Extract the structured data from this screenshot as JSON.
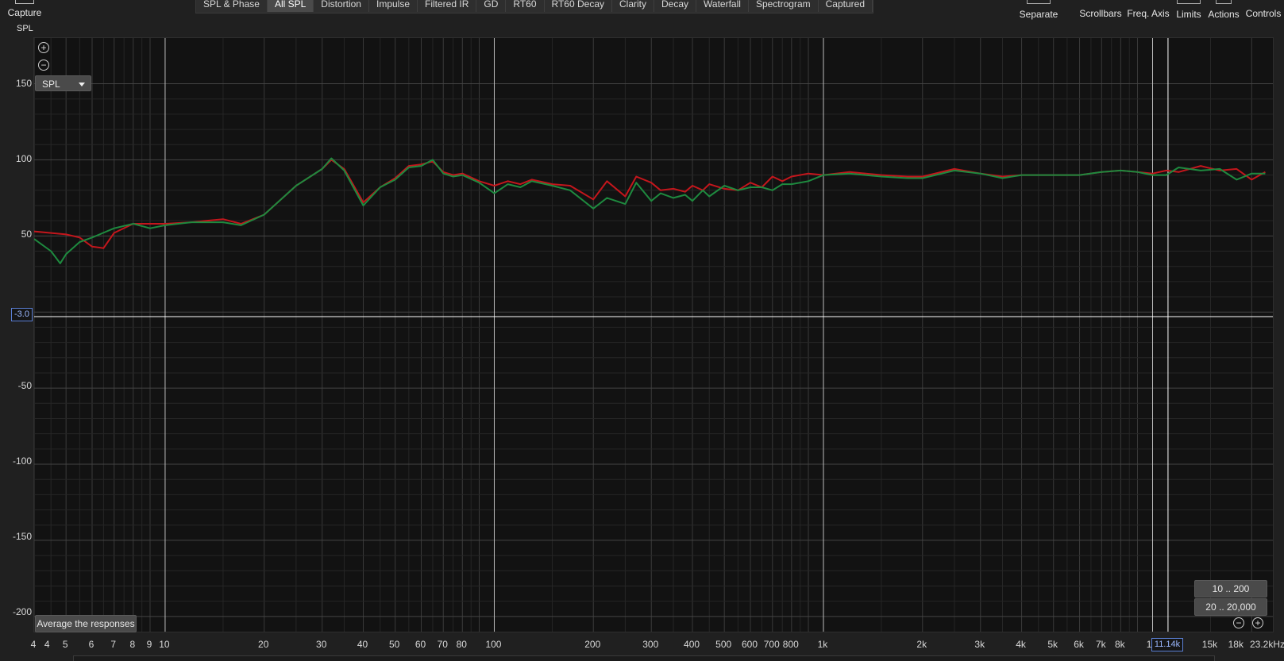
{
  "toolbar": {
    "capture_label": "Capture",
    "tabs": [
      "SPL & Phase",
      "All SPL",
      "Distortion",
      "Impulse",
      "Filtered IR",
      "GD",
      "RT60",
      "RT60 Decay",
      "Clarity",
      "Decay",
      "Waterfall",
      "Spectrogram",
      "Captured"
    ],
    "active_tab": "All SPL",
    "right_buttons": {
      "separate": "Separate",
      "scrollbars": "Scrollbars",
      "freq_axis": "Freq. Axis",
      "limits": "Limits",
      "actions": "Actions",
      "controls": "Controls"
    }
  },
  "graph": {
    "y_axis_title": "SPL",
    "spl_select": "SPL",
    "average_button": "Average the responses",
    "range_buttons": [
      "10 .. 200",
      "20 .. 20,000"
    ],
    "cursor_y_value": "-3.0",
    "cursor_x_value": "11.14k",
    "x_unit_label": "23.2kHz",
    "y_tick_labels": [
      "150",
      "100",
      "50",
      "-50",
      "-100",
      "-150",
      "-200"
    ],
    "x_tick_labels": [
      "4",
      "4",
      "5",
      "6",
      "7",
      "8",
      "9",
      "10",
      "20",
      "30",
      "40",
      "50",
      "60",
      "70",
      "80",
      "100",
      "200",
      "300",
      "400",
      "500",
      "600",
      "700",
      "800",
      "1k",
      "2k",
      "3k",
      "4k",
      "5k",
      "6k",
      "7k",
      "8k",
      "10",
      "15k",
      "18k"
    ],
    "colors": {
      "grid": "#3a3a3a",
      "grid_major": "#bdbdbd",
      "curve_red": "#c4161c",
      "curve_green": "#1e8a3f",
      "cursor": "#ffffff"
    }
  },
  "chart_data": {
    "type": "line",
    "x_scale": "log",
    "xlim": [
      4,
      23200
    ],
    "ylim": [
      -210,
      180
    ],
    "series": [
      {
        "color": "#c4161c",
        "x": [
          4,
          5,
          5.5,
          6,
          6.5,
          7,
          8,
          9,
          10,
          12,
          15,
          17,
          20,
          25,
          30,
          32,
          35,
          40,
          45,
          50,
          55,
          60,
          65,
          70,
          75,
          80,
          90,
          100,
          110,
          120,
          130,
          150,
          170,
          200,
          220,
          250,
          270,
          300,
          320,
          350,
          380,
          400,
          430,
          450,
          500,
          550,
          600,
          650,
          700,
          750,
          800,
          900,
          1000,
          1200,
          1500,
          1800,
          2000,
          2500,
          3000,
          3500,
          4000,
          5000,
          6000,
          7000,
          8000,
          9000,
          10000,
          11000,
          12000,
          14000,
          16000,
          18000,
          20000,
          22000
        ],
        "y": [
          53,
          51,
          49,
          43,
          42,
          52,
          58,
          58,
          58,
          59,
          61,
          58,
          64,
          83,
          94,
          100,
          94,
          72,
          82,
          88,
          96,
          97,
          99,
          92,
          90,
          91,
          86,
          83,
          86,
          84,
          87,
          84,
          83,
          74,
          86,
          76,
          89,
          85,
          80,
          81,
          79,
          83,
          80,
          84,
          81,
          80,
          85,
          82,
          89,
          86,
          89,
          91,
          90,
          92,
          90,
          89,
          89,
          94,
          91,
          89,
          90,
          90,
          90,
          92,
          93,
          92,
          91,
          93,
          92,
          96,
          93,
          94,
          87,
          92
        ]
      },
      {
        "color": "#1e8a3f",
        "x": [
          4,
          4.5,
          4.8,
          5,
          5.5,
          6,
          7,
          8,
          9,
          10,
          12,
          15,
          17,
          20,
          25,
          30,
          32,
          35,
          40,
          45,
          50,
          55,
          60,
          65,
          70,
          75,
          80,
          90,
          100,
          110,
          120,
          130,
          150,
          170,
          200,
          220,
          250,
          270,
          300,
          320,
          350,
          380,
          400,
          430,
          450,
          500,
          550,
          600,
          650,
          700,
          750,
          800,
          900,
          1000,
          1200,
          1500,
          1800,
          2000,
          2500,
          3000,
          3500,
          4000,
          5000,
          6000,
          7000,
          8000,
          9000,
          10000,
          11000,
          12000,
          14000,
          16000,
          18000,
          20000,
          22000
        ],
        "y": [
          48,
          40,
          32,
          38,
          46,
          49,
          55,
          58,
          55,
          57,
          59,
          59,
          57,
          64,
          83,
          94,
          101,
          93,
          70,
          82,
          87,
          95,
          96,
          100,
          91,
          89,
          90,
          85,
          78,
          84,
          82,
          86,
          83,
          80,
          68,
          75,
          71,
          85,
          73,
          78,
          75,
          77,
          73,
          80,
          76,
          83,
          80,
          82,
          82,
          80,
          84,
          84,
          86,
          90,
          91,
          89,
          88,
          88,
          93,
          91,
          88,
          90,
          90,
          90,
          92,
          93,
          92,
          90,
          90,
          95,
          93,
          94,
          87,
          91,
          91
        ]
      }
    ]
  }
}
